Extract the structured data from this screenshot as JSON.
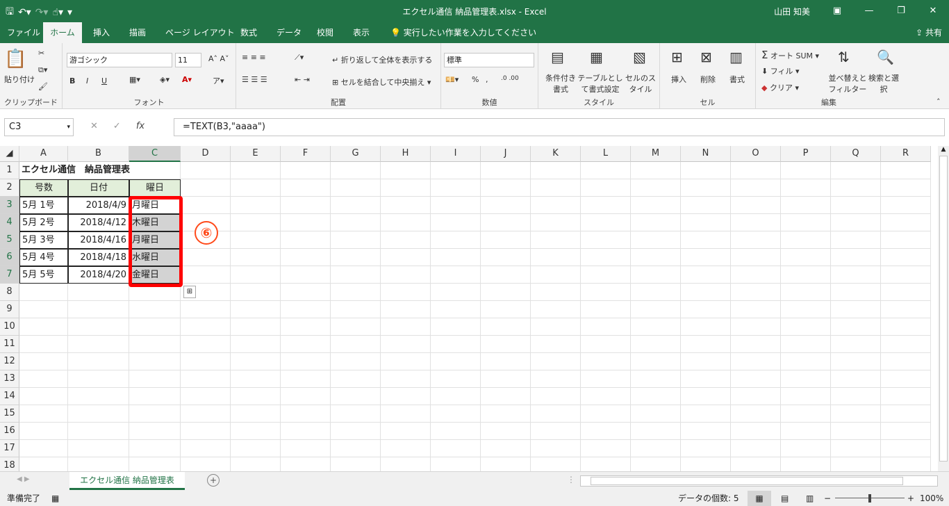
{
  "titlebar": {
    "title": "エクセル通信 納品管理表.xlsx - Excel",
    "user": "山田 知美",
    "save_icon": "save-icon",
    "undo_icon": "undo-icon",
    "redo_icon": "redo-icon",
    "touch_icon": "touch-icon"
  },
  "tabs": [
    "ファイル",
    "ホーム",
    "挿入",
    "描画",
    "ページ レイアウト",
    "数式",
    "データ",
    "校閲",
    "表示"
  ],
  "tell_me": "実行したい作業を入力してください",
  "share": "共有",
  "ribbon": {
    "clipboard": {
      "label": "クリップボード",
      "paste": "貼り付け"
    },
    "font": {
      "label": "フォント",
      "font_name": "游ゴシック",
      "font_size": "11",
      "bold": "B",
      "italic": "I",
      "underline": "U"
    },
    "alignment": {
      "label": "配置",
      "wrap": "折り返して全体を表示する",
      "merge": "セルを結合して中央揃え"
    },
    "number": {
      "label": "数値",
      "format": "標準",
      "percent": "%",
      "comma": ","
    },
    "styles": {
      "label": "スタイル",
      "cond": "条件付き書式",
      "table": "テーブルとして書式設定",
      "cell": "セルのスタイル"
    },
    "cells": {
      "label": "セル",
      "insert": "挿入",
      "delete": "削除",
      "format": "書式"
    },
    "editing": {
      "label": "編集",
      "autosum": "オート SUM",
      "fill": "フィル",
      "clear": "クリア",
      "sort": "並べ替えとフィルター",
      "find": "検索と選択"
    }
  },
  "formula_bar": {
    "name_box": "C3",
    "formula": "=TEXT(B3,\"aaaa\")",
    "fx": "fx"
  },
  "columns": [
    "A",
    "B",
    "C",
    "D",
    "E",
    "F",
    "G",
    "H",
    "I",
    "J",
    "K",
    "L",
    "M",
    "N",
    "O",
    "P",
    "Q",
    "R"
  ],
  "rows": [
    "1",
    "2",
    "3",
    "4",
    "5",
    "6",
    "7",
    "8",
    "9",
    "10",
    "11",
    "12",
    "13",
    "14",
    "15",
    "16",
    "17",
    "18"
  ],
  "sheet": {
    "title": "エクセル通信　納品管理表",
    "headers": [
      "号数",
      "日付",
      "曜日"
    ],
    "data": [
      [
        "5月 1号",
        "2018/4/9",
        "月曜日"
      ],
      [
        "5月 2号",
        "2018/4/12",
        "木曜日"
      ],
      [
        "5月 3号",
        "2018/4/16",
        "月曜日"
      ],
      [
        "5月 4号",
        "2018/4/18",
        "水曜日"
      ],
      [
        "5月 5号",
        "2018/4/20",
        "金曜日"
      ]
    ]
  },
  "annotation": "⑥",
  "sheet_tab": "エクセル通信 納品管理表",
  "status": {
    "ready": "準備完了",
    "count": "データの個数: 5",
    "zoom": "100%"
  },
  "colors": {
    "accent": "#217346",
    "highlight": "#ff0000",
    "header_fill": "#e2efda"
  }
}
